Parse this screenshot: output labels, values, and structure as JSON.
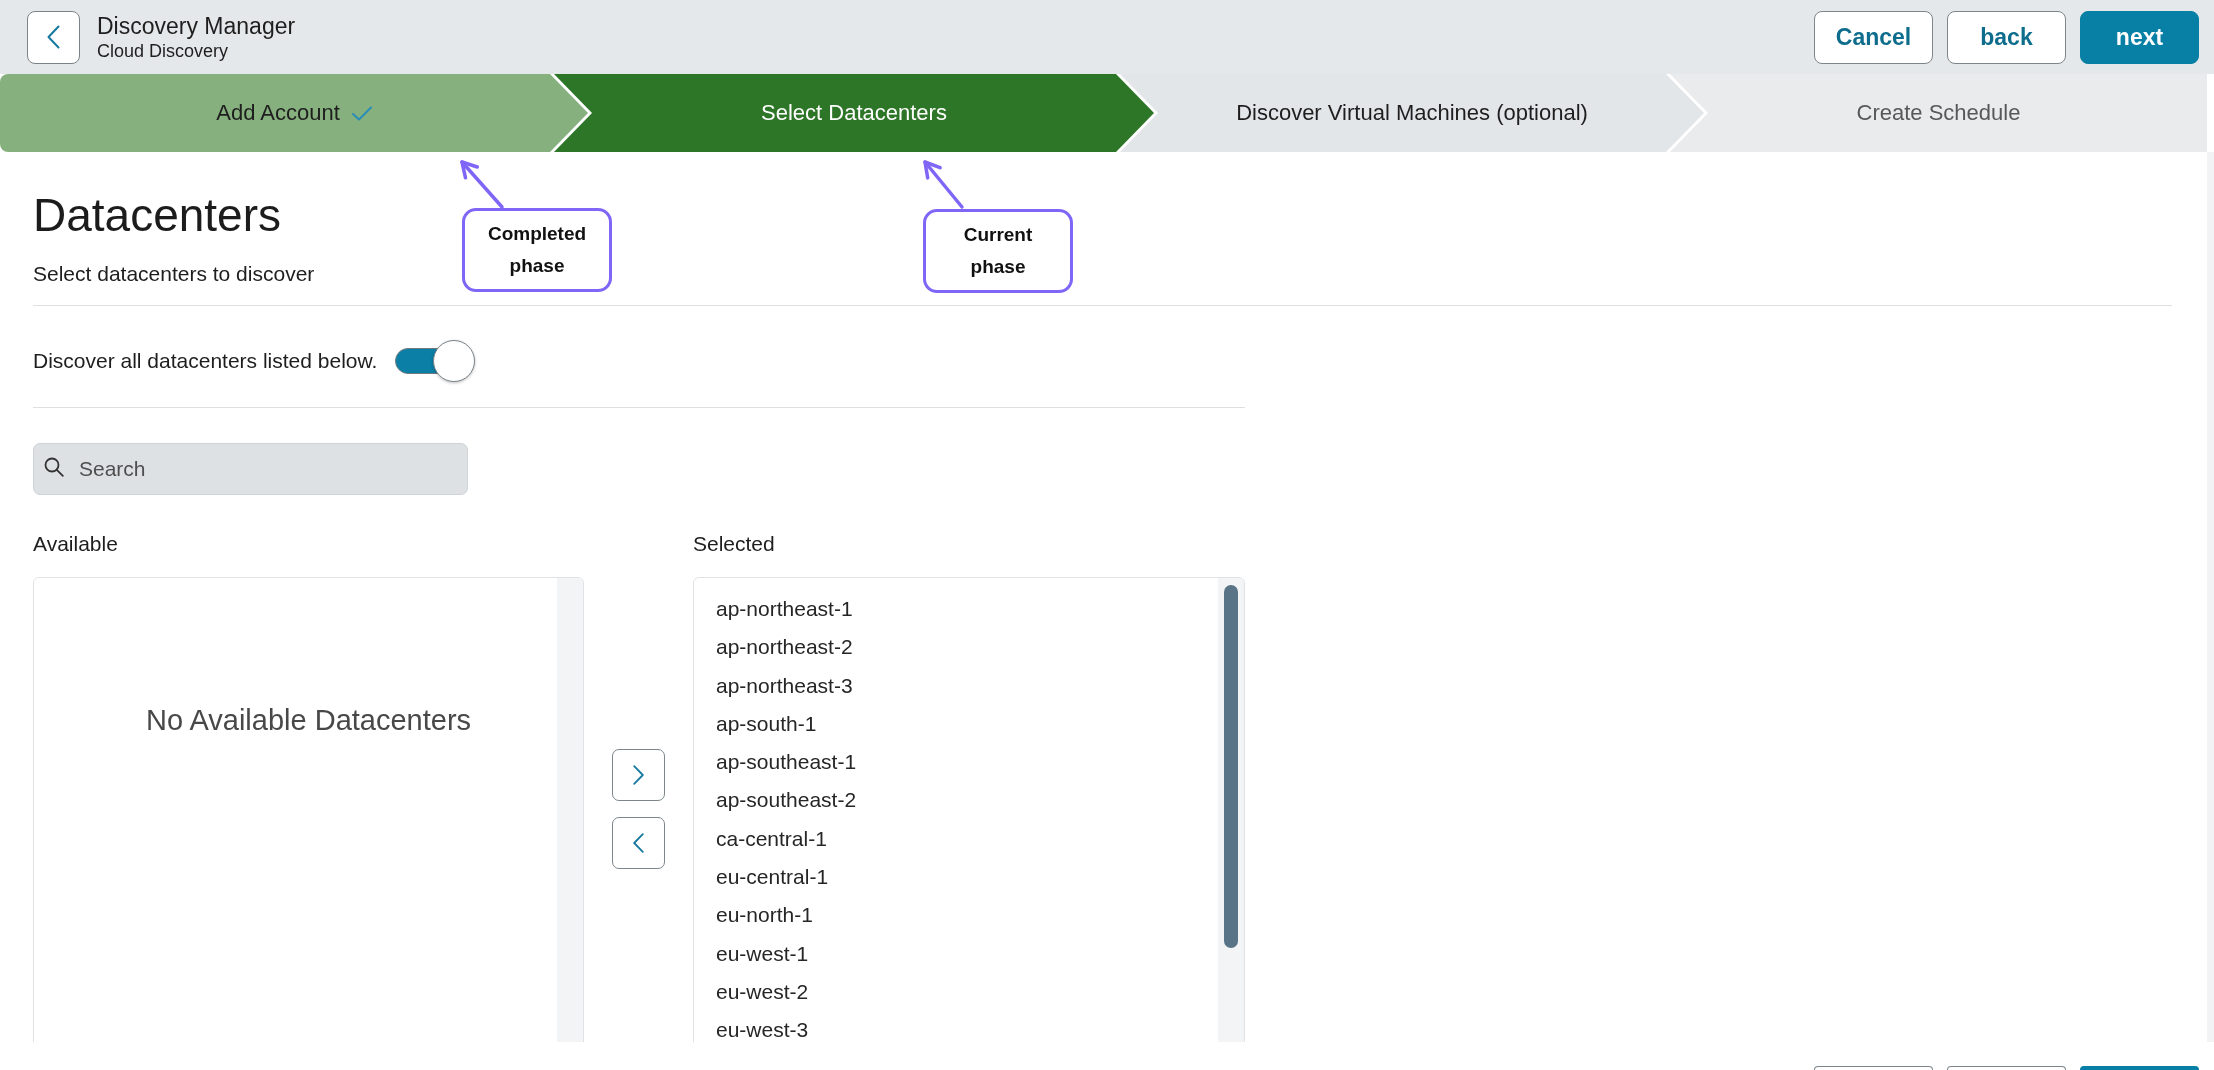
{
  "header": {
    "title": "Discovery Manager",
    "subtitle": "Cloud Discovery",
    "buttons": [
      {
        "label": "Cancel",
        "kind": "secondary"
      },
      {
        "label": "back",
        "kind": "secondary"
      },
      {
        "label": "next",
        "kind": "primary"
      }
    ]
  },
  "steps": [
    {
      "label": "Add Account",
      "completed": true,
      "selected": false,
      "disabled": false
    },
    {
      "label": "Select Datacenters",
      "completed": false,
      "selected": true,
      "disabled": false
    },
    {
      "label": "Discover Virtual Machines (optional)",
      "completed": false,
      "selected": false,
      "disabled": false
    },
    {
      "label": "Create Schedule",
      "completed": false,
      "selected": false,
      "disabled": true
    }
  ],
  "annotations": [
    {
      "text": "Completed phase"
    },
    {
      "text": "Current phase"
    }
  ],
  "page": {
    "title": "Datacenters",
    "subtitle": "Select datacenters to discover",
    "toggle": {
      "label": "Discover all datacenters listed below.",
      "on": true
    },
    "search": {
      "placeholder": "Search"
    },
    "available": {
      "label": "Available",
      "empty_text": "No Available Datacenters"
    },
    "selected": {
      "label": "Selected",
      "items": [
        "ap-northeast-1",
        "ap-northeast-2",
        "ap-northeast-3",
        "ap-south-1",
        "ap-southeast-1",
        "ap-southeast-2",
        "ca-central-1",
        "eu-central-1",
        "eu-north-1",
        "eu-west-1",
        "eu-west-2",
        "eu-west-3"
      ]
    }
  },
  "footer": {
    "buttons": [
      {
        "kind": "secondary"
      },
      {
        "kind": "secondary"
      },
      {
        "kind": "primary"
      }
    ]
  }
}
